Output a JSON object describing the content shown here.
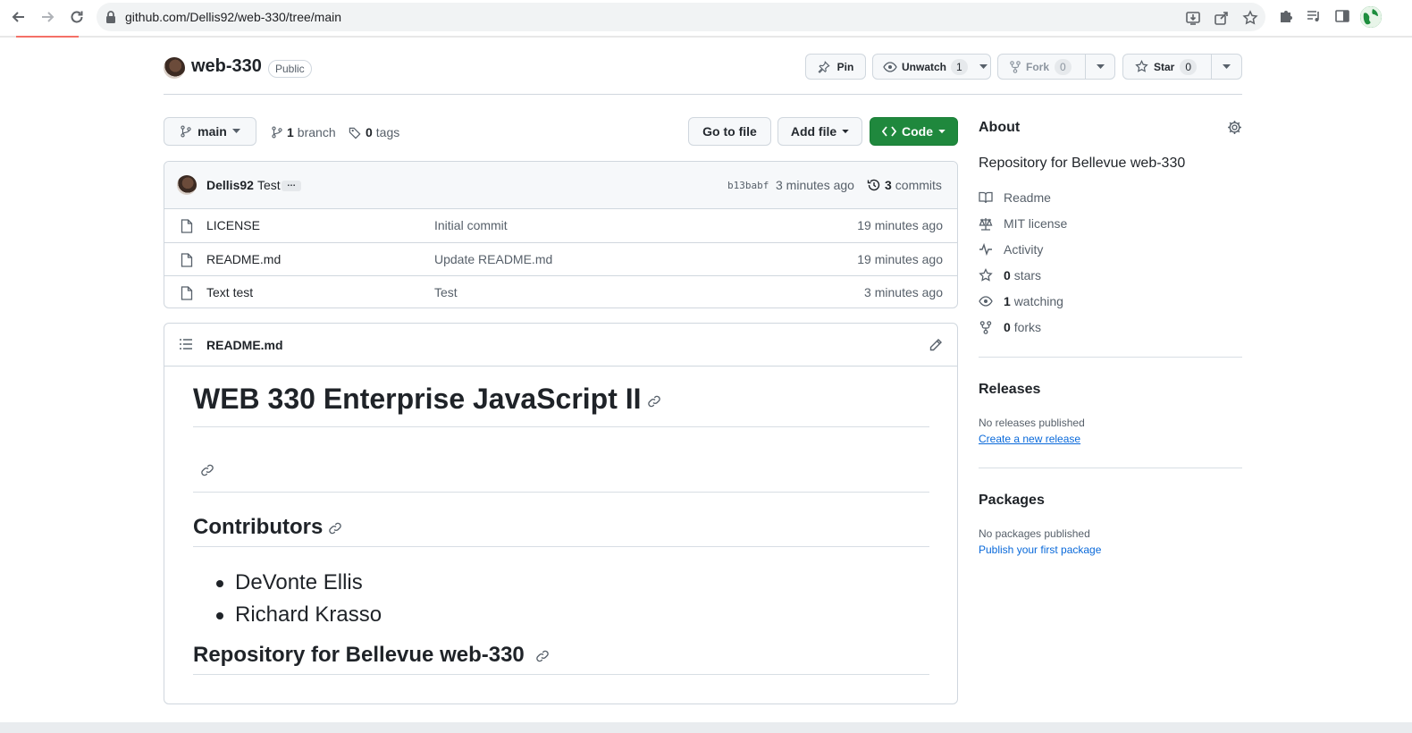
{
  "browser": {
    "url": "github.com/Dellis92/web-330/tree/main"
  },
  "repo": {
    "name": "web-330",
    "visibility": "Public",
    "pin_label": "Pin",
    "watch_label": "Unwatch",
    "watch_count": "1",
    "fork_label": "Fork",
    "fork_count": "0",
    "star_label": "Star",
    "star_count": "0"
  },
  "toolbar": {
    "branch": "main",
    "branch_count": "1",
    "branch_label": "branch",
    "tag_count": "0",
    "tag_label": "tags",
    "go_to_file": "Go to file",
    "add_file": "Add file",
    "code": "Code"
  },
  "commit": {
    "user": "Dellis92",
    "message": "Test",
    "ellipsis": "…",
    "sha": "b13babf",
    "time": "3 minutes ago",
    "count": "3",
    "count_label": "commits"
  },
  "files": [
    {
      "name": "LICENSE",
      "message": "Initial commit",
      "time": "19 minutes ago"
    },
    {
      "name": "README.md",
      "message": "Update README.md",
      "time": "19 minutes ago"
    },
    {
      "name": "Text test",
      "message": "Test",
      "time": "3 minutes ago"
    }
  ],
  "readme": {
    "filename": "README.md",
    "h1": "WEB 330 Enterprise JavaScript II",
    "contributors_heading": "Contributors",
    "contributors": [
      "DeVonte Ellis",
      "Richard Krasso"
    ],
    "repo_heading": "Repository for Bellevue web-330"
  },
  "sidebar": {
    "about_title": "About",
    "description": "Repository for Bellevue web-330",
    "readme": "Readme",
    "license": "MIT license",
    "activity": "Activity",
    "stars_count": "0",
    "stars_label": "stars",
    "watching_count": "1",
    "watching_label": "watching",
    "forks_count": "0",
    "forks_label": "forks",
    "releases_title": "Releases",
    "no_releases": "No releases published",
    "create_release": "Create a new release",
    "packages_title": "Packages",
    "no_packages": "No packages published",
    "publish_package": "Publish your first package"
  },
  "colors": {
    "accent_green": "#1f883d",
    "link_blue": "#0969da",
    "muted_text": "#57606a",
    "border": "#d0d7de"
  }
}
